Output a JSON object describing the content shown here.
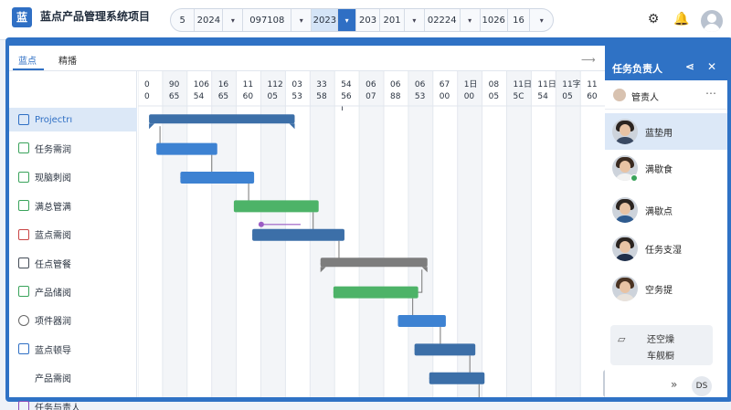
{
  "app": {
    "logo_char": "蓝",
    "title": "蓝点产品管理系统项目"
  },
  "datebar": {
    "segments": [
      "5",
      "2024",
      "▾",
      "097108",
      "▾",
      "2023",
      "▾",
      "203",
      "201",
      "▾",
      "02224",
      "▾",
      "1026",
      "16",
      "▾"
    ]
  },
  "header_icons": [
    "settings-icon",
    "notification-icon",
    "user-avatar"
  ],
  "tabs": [
    {
      "label": "蓝点"
    },
    {
      "label": "精播"
    }
  ],
  "tasks": [
    {
      "label": "Projectrı",
      "icon": "blue"
    },
    {
      "label": "任务需润",
      "icon": "green"
    },
    {
      "label": "现脑刺阅",
      "icon": "green"
    },
    {
      "label": "满总管满",
      "icon": "green"
    },
    {
      "label": "蓝点需阅",
      "icon": "red"
    },
    {
      "label": "任点管餐",
      "icon": "dark"
    },
    {
      "label": "产品储阅",
      "icon": "green"
    },
    {
      "label": "项件器润",
      "icon": "circle"
    },
    {
      "label": "蓝点顿导",
      "icon": "blue"
    },
    {
      "label": "产品需阅",
      "icon": "none"
    },
    {
      "label": "任务与责人",
      "icon": "purple"
    }
  ],
  "timeline": {
    "columns": [
      [
        "0",
        "0",
        ""
      ],
      [
        "90",
        "65",
        ""
      ],
      [
        "106",
        "54",
        ""
      ],
      [
        "16",
        "65",
        ""
      ],
      [
        "11",
        "60",
        ""
      ],
      [
        "112",
        "05",
        ""
      ],
      [
        "03",
        "53",
        ""
      ],
      [
        "33",
        "58",
        ""
      ],
      [
        "54",
        "56",
        "ı"
      ],
      [
        "06",
        "07",
        ""
      ],
      [
        "06",
        "88",
        ""
      ],
      [
        "06",
        "53",
        ""
      ],
      [
        "67",
        "00",
        ""
      ],
      [
        "1日",
        "00",
        ""
      ],
      [
        "08",
        "05",
        ""
      ],
      [
        "11日",
        "5C",
        ""
      ],
      [
        "11日",
        "54",
        ""
      ],
      [
        "11字",
        "05",
        ""
      ],
      [
        "11",
        "60",
        ""
      ]
    ]
  },
  "gantt_bars": [
    {
      "row": 0,
      "start": 0.6,
      "end": 8.5,
      "color": "#3c6fa8",
      "summary": true
    },
    {
      "row": 1,
      "start": 1.0,
      "end": 4.3,
      "color": "#3d82d2"
    },
    {
      "row": 2,
      "start": 2.3,
      "end": 6.3,
      "color": "#3d82d2"
    },
    {
      "row": 3,
      "start": 5.2,
      "end": 9.8,
      "color": "#4db368"
    },
    {
      "row": 4,
      "start": 6.2,
      "end": 11.2,
      "color": "#3c6fa8"
    },
    {
      "row": 5,
      "start": 9.9,
      "end": 15.7,
      "color": "#7d7d7d",
      "summary": true
    },
    {
      "row": 6,
      "start": 10.6,
      "end": 15.2,
      "color": "#4db368"
    },
    {
      "row": 7,
      "start": 14.1,
      "end": 16.7,
      "color": "#3d82d2"
    },
    {
      "row": 8,
      "start": 15.0,
      "end": 18.3,
      "color": "#3c6fa8"
    },
    {
      "row": 9,
      "start": 15.8,
      "end": 18.8,
      "color": "#3c6fa8"
    },
    {
      "row": 10,
      "start": 18.8,
      "end": 22.2,
      "color": "#9b5cc4"
    }
  ],
  "right_panel": {
    "title": "任务负责人",
    "owner_label": "管责人",
    "people": [
      {
        "name": "蓝垫用",
        "selected": true
      },
      {
        "name": "满歇食",
        "online": true
      },
      {
        "name": "满歇点"
      },
      {
        "name": "任务支湿"
      },
      {
        "name": "空务提"
      }
    ],
    "card": {
      "line1": "还空燥",
      "line2": "车舰橱"
    },
    "footer_badge": "DS"
  },
  "colors": {
    "accent": "#2f6fc4",
    "frame": "#2f72c5",
    "green": "#4db368",
    "purple": "#9b5cc4"
  }
}
